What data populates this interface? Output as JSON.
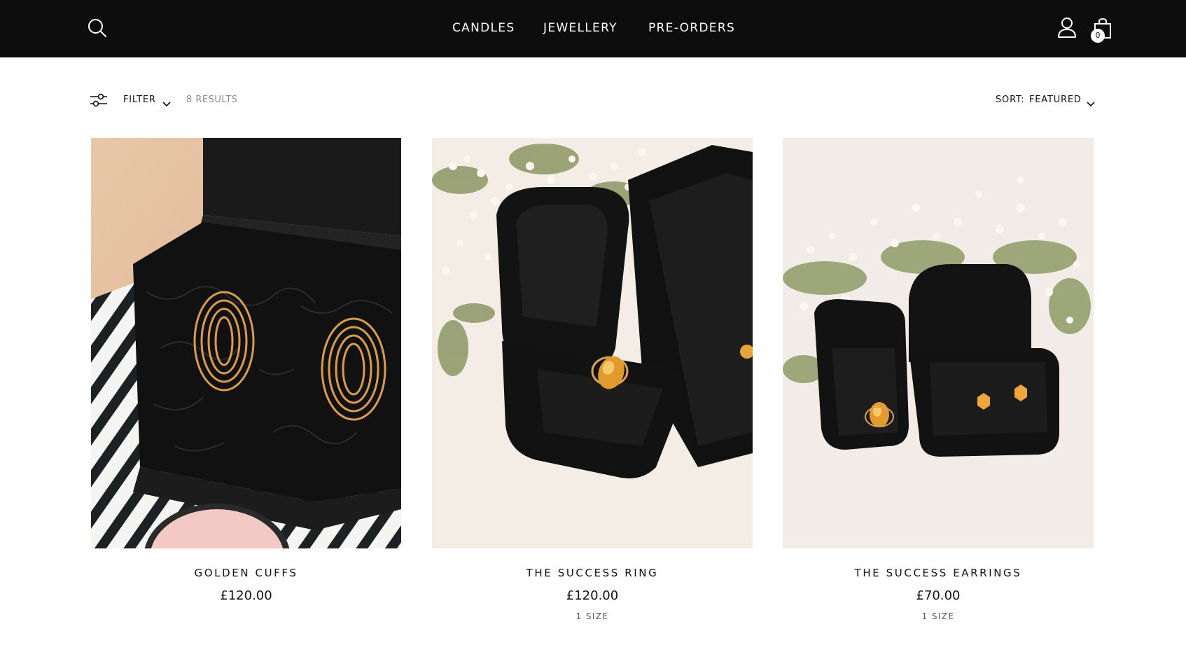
{
  "header": {
    "nav": [
      "CANDLES",
      "JEWELLERY",
      "PRE-ORDERS"
    ],
    "cart_count": "0"
  },
  "toolbar": {
    "filter_label": "FILTER",
    "results": "8 RESULTS",
    "sort_label": "SORT:",
    "sort_value": "FEATURED"
  },
  "products": [
    {
      "name": "GOLDEN CUFFS",
      "price": "£120.00",
      "size": ""
    },
    {
      "name": "THE SUCCESS RING",
      "price": "£120.00",
      "size": "1 SIZE"
    },
    {
      "name": "THE SUCCESS EARRINGS",
      "price": "£70.00",
      "size": "1 SIZE"
    }
  ],
  "colors": {
    "header_bg": "#0d0d0d",
    "page_bg": "#ffffff",
    "muted_text": "#8a8a8a"
  }
}
